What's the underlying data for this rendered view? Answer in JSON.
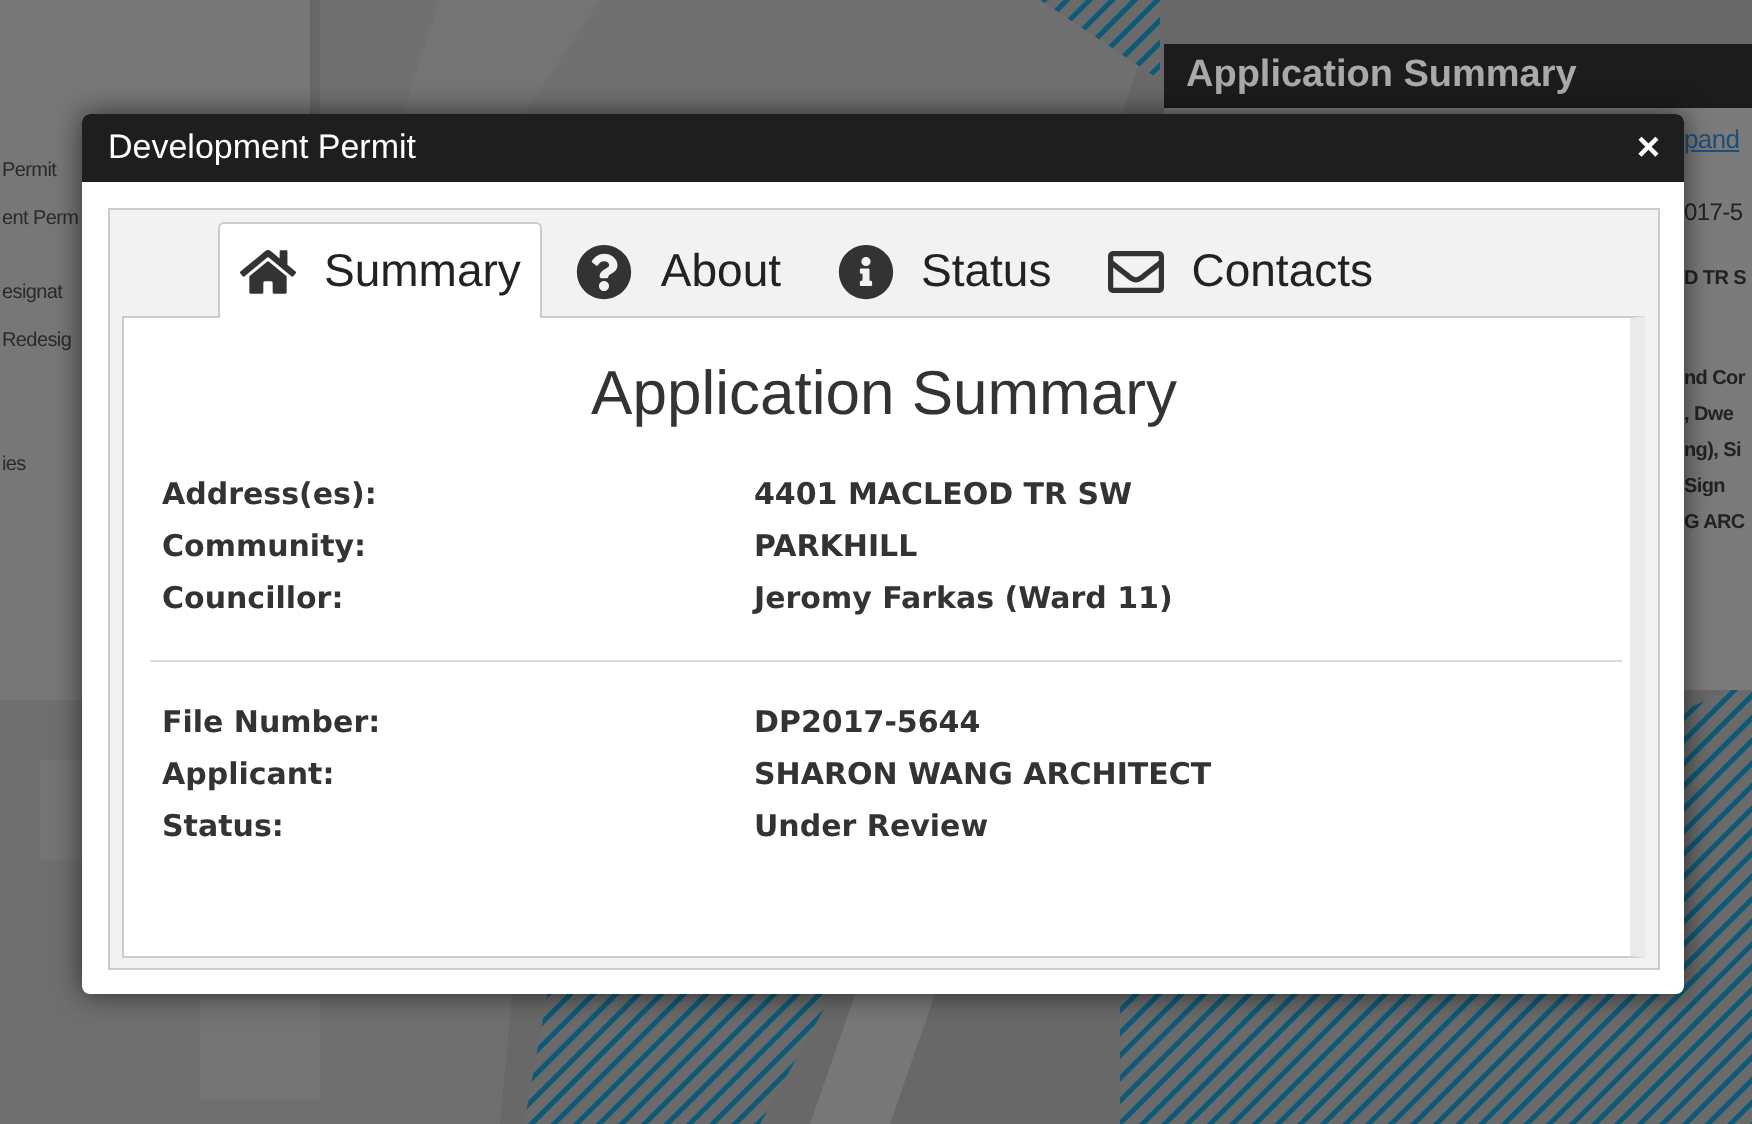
{
  "background_left_panel": {
    "items": [
      "Permit",
      "ent Perm",
      "esignat",
      "Redesig",
      "ies"
    ]
  },
  "background_right_panel": {
    "title": "Application Summary",
    "link": "pand",
    "lines": [
      {
        "kind": "number",
        "text": "017-5"
      },
      {
        "kind": "text",
        "text": "D TR S"
      },
      {
        "kind": "text",
        "text": "nd Cor"
      },
      {
        "kind": "text",
        "text": ", Dwe"
      },
      {
        "kind": "text",
        "text": "ng), Si"
      },
      {
        "kind": "text",
        "text": "Sign"
      },
      {
        "kind": "text",
        "text": "G ARC"
      }
    ]
  },
  "dialog": {
    "title": "Development Permit",
    "close": "×",
    "tabs": [
      {
        "label": "Summary",
        "selected": true
      },
      {
        "label": "About",
        "selected": false
      },
      {
        "label": "Status",
        "selected": false
      },
      {
        "label": "Contacts",
        "selected": false
      }
    ],
    "heading": "Application Summary",
    "sections": [
      {
        "rows": [
          {
            "label": "Address(es):",
            "value": "4401 MACLEOD TR SW"
          },
          {
            "label": "Community:",
            "value": "PARKHILL"
          },
          {
            "label": "Councillor:",
            "value": "Jeromy Farkas (Ward 11)"
          }
        ]
      },
      {
        "rows": [
          {
            "label": "File Number:",
            "value": "DP2017-5644"
          },
          {
            "label": "Applicant:",
            "value": "SHARON WANG ARCHITECT"
          },
          {
            "label": "Status:",
            "value": "Under Review"
          }
        ]
      }
    ]
  }
}
